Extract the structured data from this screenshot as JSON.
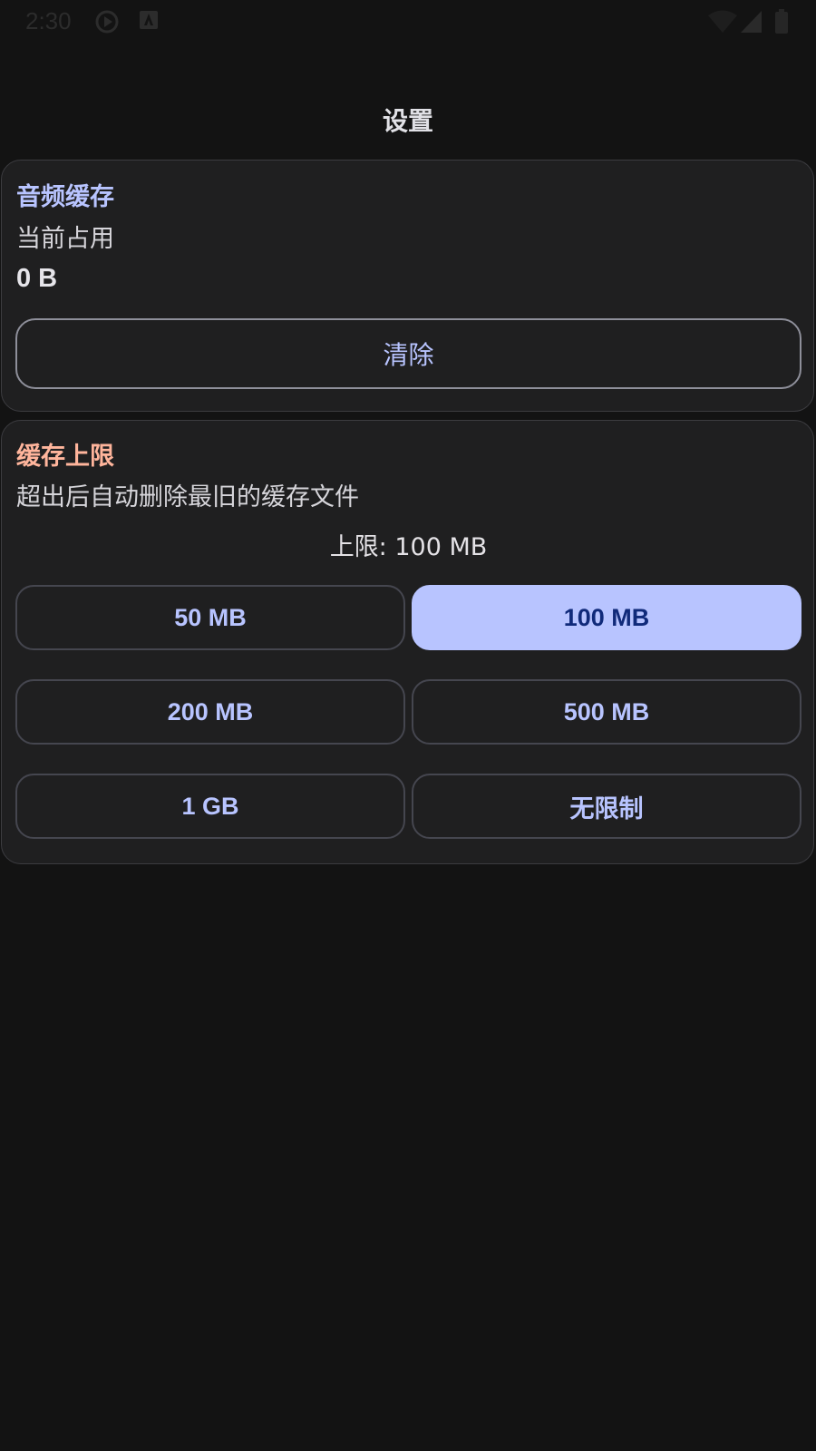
{
  "status_bar": {
    "time": "2:30"
  },
  "page": {
    "title": "设置"
  },
  "audio_cache": {
    "title": "音频缓存",
    "usage_label": "当前占用",
    "usage_value": "0 B",
    "clear_label": "清除"
  },
  "cache_limit": {
    "title": "缓存上限",
    "description": "超出后自动删除最旧的缓存文件",
    "current_limit": "上限: 100 MB",
    "options": [
      {
        "label": "50 MB",
        "selected": false
      },
      {
        "label": "100 MB",
        "selected": true
      },
      {
        "label": "200 MB",
        "selected": false
      },
      {
        "label": "500 MB",
        "selected": false
      },
      {
        "label": "1 GB",
        "selected": false
      },
      {
        "label": "无限制",
        "selected": false
      }
    ]
  },
  "colors": {
    "background": "#131313",
    "card": "#1f1f20",
    "primary": "#b8c4ff",
    "on_primary": "#102a7a",
    "tertiary": "#ffb59c"
  },
  "icons": [
    "play-circle-icon",
    "font-notification-icon",
    "wifi-icon",
    "signal-icon",
    "battery-icon"
  ]
}
